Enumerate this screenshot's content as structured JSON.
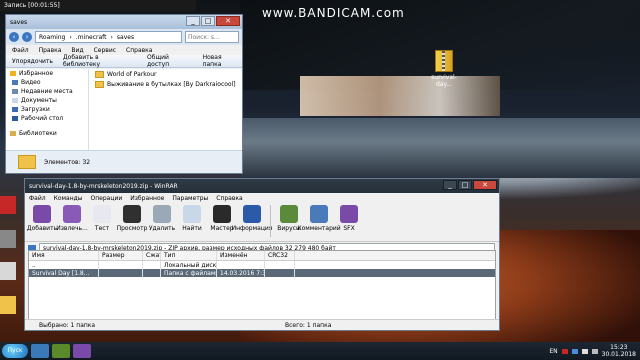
{
  "recorder": {
    "label": "Запись [00:01:55]"
  },
  "watermark": {
    "text": "www.BANDICAM.com"
  },
  "desktop_file": {
    "name": "survival-day..."
  },
  "explorer": {
    "title": "saves",
    "breadcrumb": [
      "Roaming",
      ".minecraft",
      "saves"
    ],
    "search_placeholder": "Поиск: s...",
    "menu": [
      "Файл",
      "Правка",
      "Вид",
      "Сервис",
      "Справка"
    ],
    "toolbar": [
      "Упорядочить",
      "Добавить в библиотеку",
      "Общий доступ",
      "Новая папка"
    ],
    "nav": {
      "favorites_label": "Избранное",
      "favorites": [
        "Видео",
        "Недавние места",
        "Документы",
        "Загрузки",
        "Рабочий стол"
      ],
      "libraries_label": "Библиотеки"
    },
    "folders": [
      "World of Parkour",
      "Выживание в бутылках [By Darkraiocool]"
    ],
    "status": "Элементов: 32"
  },
  "winrar": {
    "title": "survival-day-1.8-by-mrskeleton2019.zip - WinRAR",
    "menu": [
      "Файл",
      "Команды",
      "Операции",
      "Избранное",
      "Параметры",
      "Справка"
    ],
    "tools": [
      {
        "label": "Добавить",
        "color": "#7a4aa8"
      },
      {
        "label": "Извлечь...",
        "color": "#8a5ab8"
      },
      {
        "label": "Тест",
        "color": "#e8e8f0"
      },
      {
        "label": "Просмотр",
        "color": "#303030"
      },
      {
        "label": "Удалить",
        "color": "#9aa8b8"
      },
      {
        "label": "Найти",
        "color": "#c8d8e8"
      },
      {
        "label": "Мастер",
        "color": "#2a2a2a"
      },
      {
        "label": "Информация",
        "color": "#2a5aa8"
      },
      {
        "label": "Вирусы",
        "color": "#5a8a3a"
      },
      {
        "label": "Комментарий",
        "color": "#4a7ab8"
      },
      {
        "label": "SFX",
        "color": "#7a4aa8"
      }
    ],
    "path": "survival-day-1.8-by-mrskeleton2019.zip - ZIP архив, размер исходных файлов 32 279 480 байт",
    "columns": [
      "Имя",
      "Размер",
      "Сжат",
      "Тип",
      "Изменён",
      "CRC32"
    ],
    "rows": [
      {
        "name": "..",
        "size": "",
        "packed": "",
        "type": "Локальный диск",
        "modified": "",
        "crc": ""
      },
      {
        "name": "Survival Day [1.8...",
        "size": "",
        "packed": "",
        "type": "Папка с файлами",
        "modified": "14.03.2016 7:37",
        "crc": ""
      }
    ],
    "status_left": "Выбрано: 1 папка",
    "status_right": "Всего: 1 папка"
  },
  "taskbar": {
    "start": "Пуск",
    "lang": "EN",
    "time": "15:23",
    "date": "30.01.2018"
  }
}
